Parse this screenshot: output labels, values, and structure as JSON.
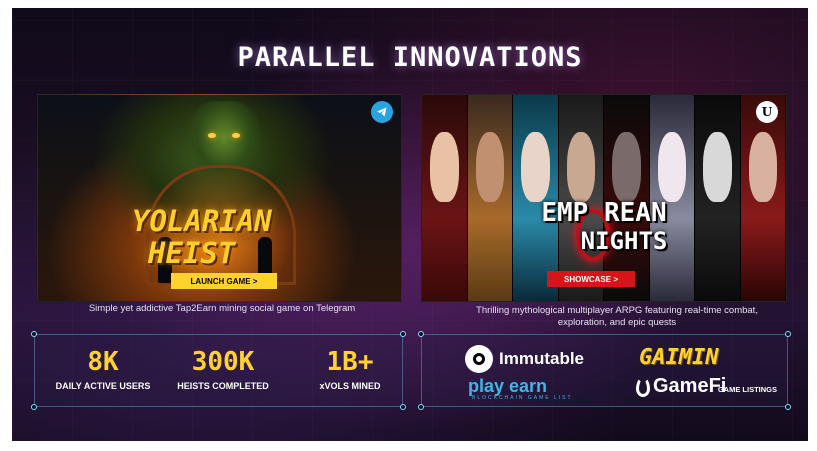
{
  "title": "PARALLEL INNOVATIONS",
  "left_game": {
    "logo_line1": "YOLARIAN",
    "logo_line2": "HEIST",
    "cta": "LAUNCH GAME >",
    "platform_icon": "telegram-icon",
    "description": "Simple yet addictive Tap2Earn mining social game on Telegram"
  },
  "right_game": {
    "logo_line1": "EMP REAN",
    "logo_line2": "NIGHTS",
    "cta": "SHOWCASE >",
    "engine_icon": "unreal-engine-icon",
    "description": "Thrilling mythological multiplayer ARPG featuring real-time combat, exploration, and epic quests"
  },
  "stats": [
    {
      "value": "8K",
      "label": "DAILY ACTIVE USERS"
    },
    {
      "value": "300K",
      "label": "HEISTS COMPLETED"
    },
    {
      "value": "1B+",
      "label": "xVOLS MINED"
    }
  ],
  "listings": {
    "immutable": "Immutable",
    "gaimin": "GAIMIN",
    "p2e": "play earn",
    "p2e_sub": "BLOCKCHAIN  GAME LIST",
    "gamefi": "GameFi",
    "caption": "GAME LISTINGS"
  },
  "colors": {
    "accent_yellow": "#ffd22e",
    "accent_red": "#d8141b",
    "telegram_blue": "#2aa3e0"
  }
}
